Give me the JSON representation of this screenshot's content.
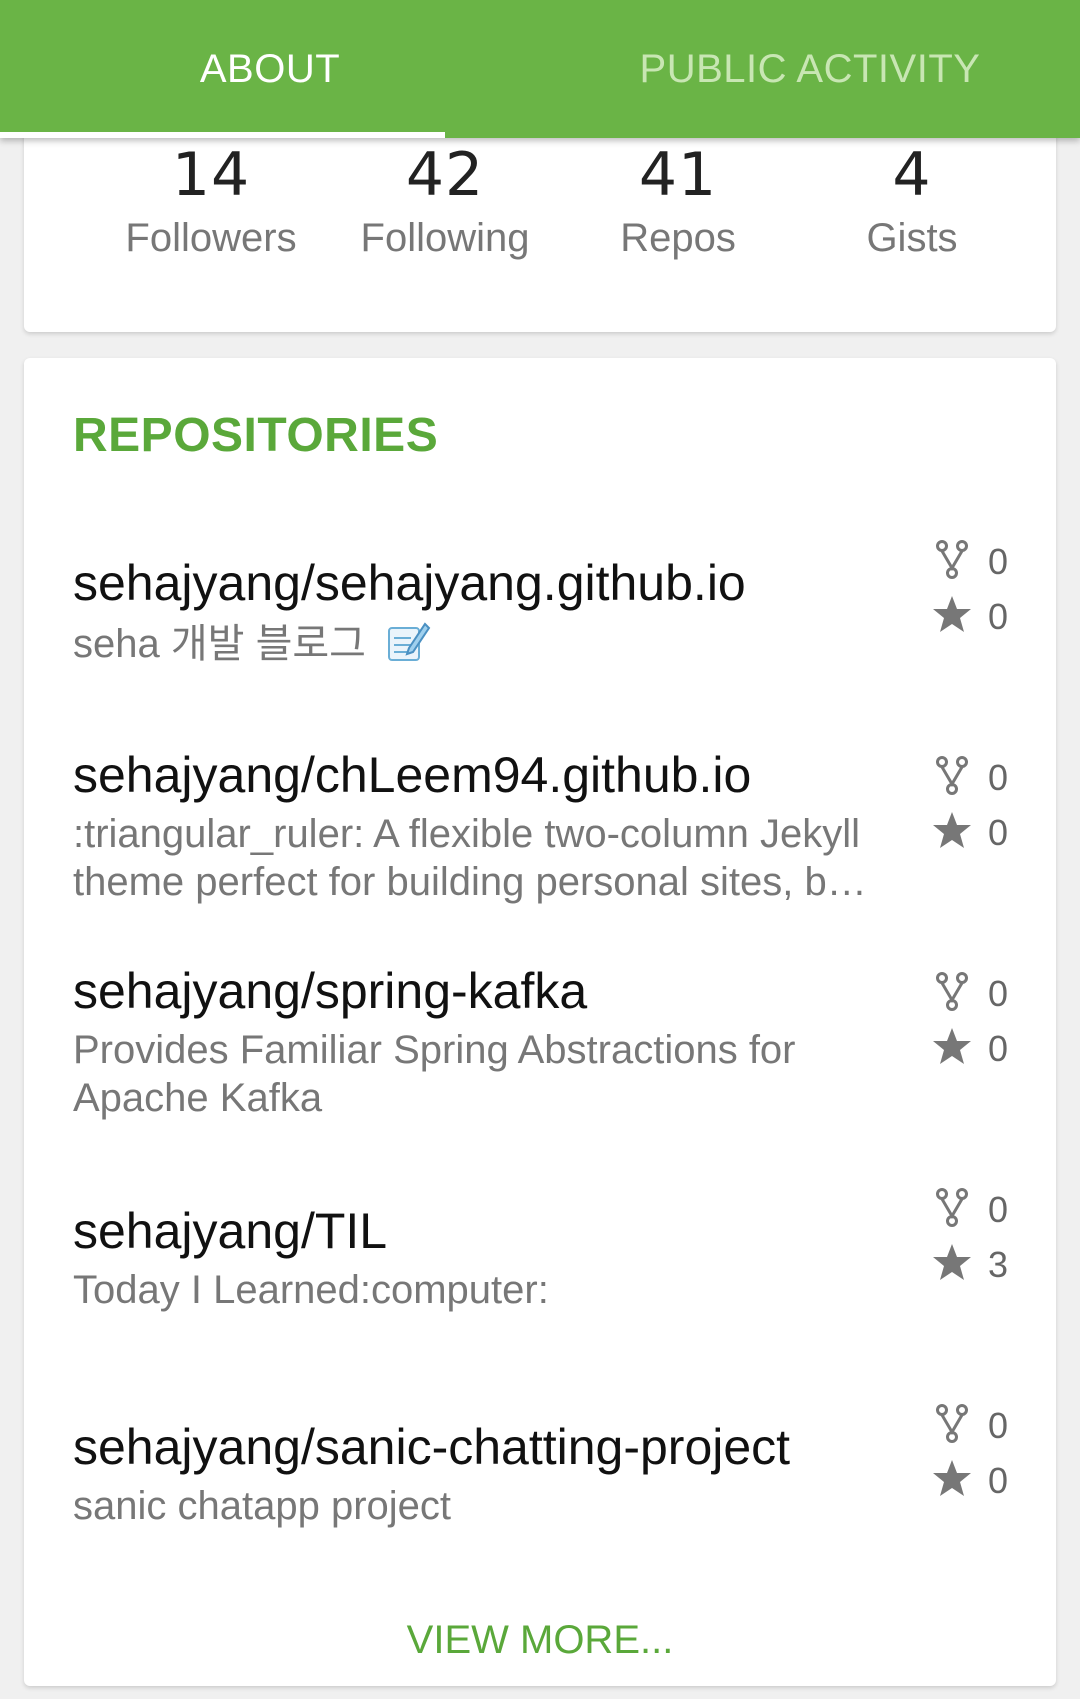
{
  "tabs": {
    "about": "ABOUT",
    "public_activity": "PUBLIC ACTIVITY"
  },
  "stats": [
    {
      "value": "14",
      "label": "Followers"
    },
    {
      "value": "42",
      "label": "Following"
    },
    {
      "value": "41",
      "label": "Repos"
    },
    {
      "value": "4",
      "label": "Gists"
    }
  ],
  "repositories": {
    "title": "REPOSITORIES",
    "items": [
      {
        "name": "sehajyang/sehajyang.github.io",
        "description": "seha 개발 블로그",
        "forks": "0",
        "stars": "0"
      },
      {
        "name": "sehajyang/chLeem94.github.io",
        "description": ":triangular_ruler: A flexible two-column Jekyll theme perfect for building personal sites, b…",
        "forks": "0",
        "stars": "0"
      },
      {
        "name": "sehajyang/spring-kafka",
        "description": "Provides Familiar Spring Abstractions for Apache Kafka",
        "forks": "0",
        "stars": "0"
      },
      {
        "name": "sehajyang/TIL",
        "description": "Today I Learned:computer:",
        "forks": "0",
        "stars": "3"
      },
      {
        "name": "sehajyang/sanic-chatting-project",
        "description": "sanic chatapp project",
        "forks": "0",
        "stars": "0"
      }
    ],
    "view_more": "VIEW MORE..."
  },
  "colors": {
    "accent": "#6ab446",
    "accent_text": "#5aa83a"
  },
  "icons": {
    "fork": "fork-icon",
    "star": "star-icon",
    "memo": "memo-icon"
  }
}
